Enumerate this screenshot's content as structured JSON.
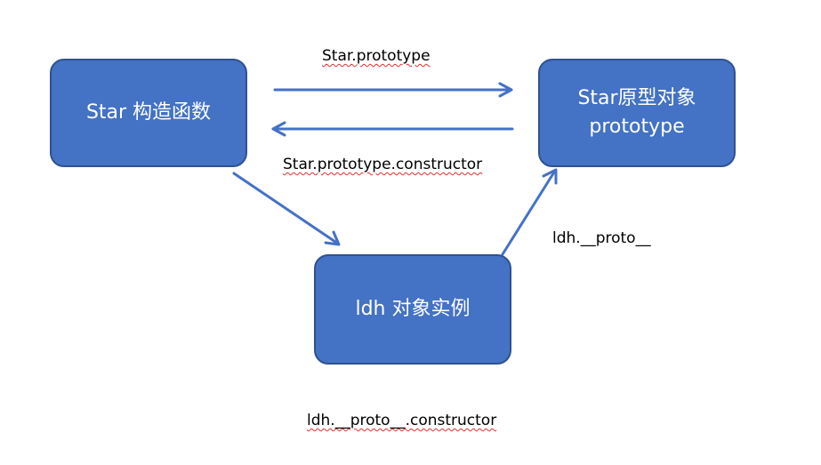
{
  "colors": {
    "node_fill": "#4472c4",
    "node_border": "#2f528f",
    "node_text": "#ffffff",
    "arrow": "#4472c4",
    "label_text": "#000000",
    "spellcheck_underline": "#e03030"
  },
  "nodes": {
    "constructor": {
      "label": "Star 构造函数"
    },
    "prototype": {
      "line1": "Star原型对象",
      "line2": "prototype"
    },
    "instance": {
      "label": "ldh 对象实例"
    }
  },
  "edges": {
    "constructor_to_prototype": {
      "label": "Star.prototype"
    },
    "prototype_to_constructor": {
      "label": "Star.prototype.constructor"
    },
    "constructor_to_instance": {
      "label": ""
    },
    "instance_to_prototype": {
      "label": "ldh.__proto__"
    }
  },
  "footer": {
    "label": "ldh.__proto__.constructor"
  }
}
